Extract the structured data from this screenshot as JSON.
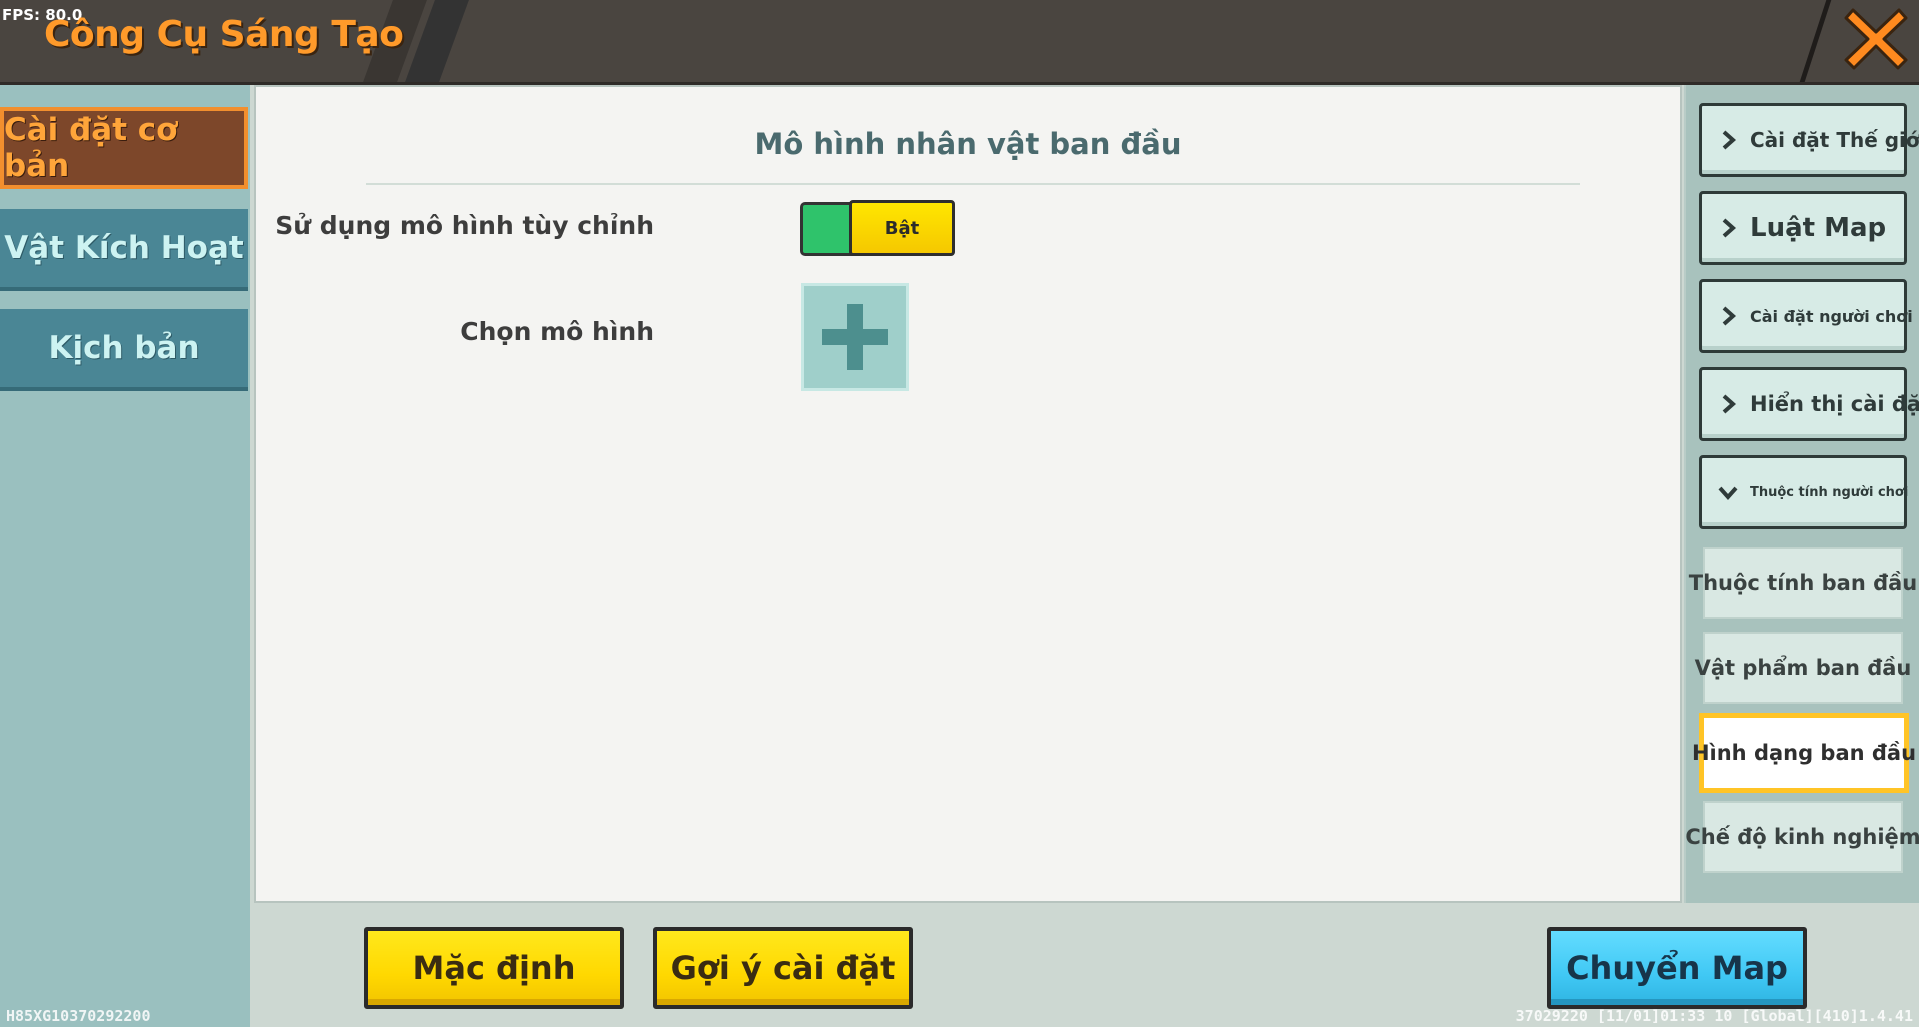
{
  "header": {
    "fps": "FPS: 80.0",
    "title": "Công Cụ Sáng Tạo",
    "close_icon": "close-x-icon"
  },
  "left_nav": {
    "items": [
      {
        "label": "Cài đặt cơ bản",
        "active": true
      },
      {
        "label": "Vật Kích Hoạt",
        "active": false
      },
      {
        "label": "Kịch bản",
        "active": false
      }
    ]
  },
  "main": {
    "section_title": "Mô hình nhân vật ban đầu",
    "use_custom_model_label": "Sử dụng mô hình tùy chỉnh",
    "toggle_state": "Bật",
    "choose_model_label": "Chọn mô hình",
    "add_icon": "plus-icon"
  },
  "bottom": {
    "default_button": "Mặc định",
    "suggest_button": "Gợi ý cài đặt",
    "switch_map_button": "Chuyển Map"
  },
  "right_nav": {
    "categories": [
      {
        "label": "Cài đặt Thế giới",
        "expanded": false
      },
      {
        "label": "Luật Map",
        "expanded": false
      },
      {
        "label": "Cài đặt người chơi",
        "expanded": false
      },
      {
        "label": "Hiển thị cài đặt",
        "expanded": false
      },
      {
        "label": "Thuộc tính người chơi",
        "expanded": true
      }
    ],
    "sub_items": [
      {
        "label": "Thuộc tính ban đầu",
        "active": false
      },
      {
        "label": "Vật phẩm ban đầu",
        "active": false
      },
      {
        "label": "Hình dạng ban đầu",
        "active": true
      },
      {
        "label": "Chế độ kinh nghiệm",
        "active": false
      }
    ]
  },
  "footer": {
    "left_id": "H85XG10370292200",
    "right_info": "37029220   [11/01]01:33 10  [Global][410]1.4.41"
  },
  "colors": {
    "header_bg": "#4a4540",
    "title_orange": "#ff9a2a",
    "active_tab_bg": "#7d472a",
    "tab_bg": "#4a8695",
    "toggle_green": "#2fc36b",
    "button_yellow": "#ffd800",
    "button_blue": "#40c8f4",
    "selected_border": "#ffc426"
  }
}
